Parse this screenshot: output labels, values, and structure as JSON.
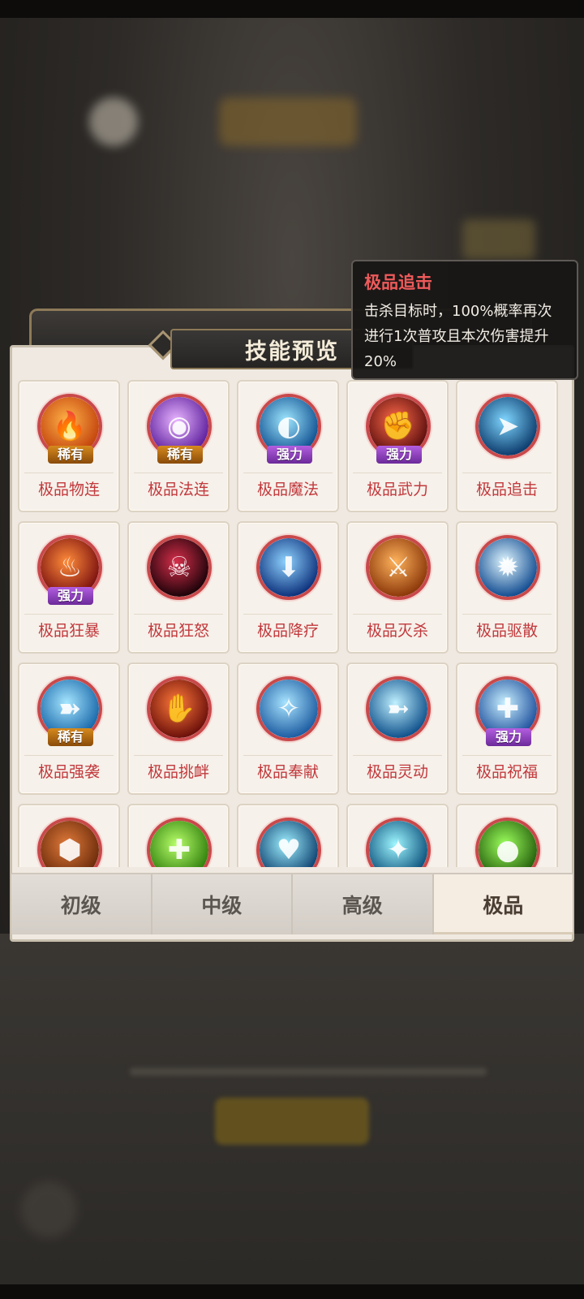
{
  "panel": {
    "title": "技能预览"
  },
  "tooltip": {
    "title": "极品追击",
    "description": "击杀目标时，100%概率再次进行1次普攻且本次伤害提升20%"
  },
  "skills": [
    {
      "label": "极品物连",
      "badge": "稀有",
      "badge_type": "rare",
      "icon": "fire-swirl-icon",
      "colors": [
        "#ffb347",
        "#c2410c"
      ]
    },
    {
      "label": "极品法连",
      "badge": "稀有",
      "badge_type": "rare",
      "icon": "magic-orb-icon",
      "colors": [
        "#e8b4ff",
        "#5b1d9b"
      ]
    },
    {
      "label": "极品魔法",
      "badge": "强力",
      "badge_type": "strong",
      "icon": "water-swirl-icon",
      "colors": [
        "#9ee7ff",
        "#0e4e8f"
      ]
    },
    {
      "label": "极品武力",
      "badge": "强力",
      "badge_type": "strong",
      "icon": "red-fist-icon",
      "colors": [
        "#ff6b4a",
        "#5a0d0d"
      ]
    },
    {
      "label": "极品追击",
      "badge": "",
      "badge_type": "",
      "icon": "running-figure-icon",
      "colors": [
        "#7fd6ff",
        "#0b3a6b"
      ]
    },
    {
      "label": "极品狂暴",
      "badge": "强力",
      "badge_type": "strong",
      "icon": "rage-figure-icon",
      "colors": [
        "#ff8c3a",
        "#7a0f0f"
      ]
    },
    {
      "label": "极品狂怒",
      "badge": "",
      "badge_type": "",
      "icon": "demon-face-icon",
      "colors": [
        "#d62e4a",
        "#1a0208"
      ]
    },
    {
      "label": "极品降疗",
      "badge": "",
      "badge_type": "",
      "icon": "down-arrow-icon",
      "colors": [
        "#8fd3ff",
        "#0b2f7a"
      ]
    },
    {
      "label": "极品灭杀",
      "badge": "",
      "badge_type": "",
      "icon": "fighter-icon",
      "colors": [
        "#ffb35c",
        "#8a3608"
      ]
    },
    {
      "label": "极品驱散",
      "badge": "",
      "badge_type": "",
      "icon": "light-burst-icon",
      "colors": [
        "#e0f6ff",
        "#0f4a8f"
      ]
    },
    {
      "label": "极品强袭",
      "badge": "稀有",
      "badge_type": "rare",
      "icon": "feather-icon",
      "colors": [
        "#a6e6ff",
        "#1565a8"
      ]
    },
    {
      "label": "极品挑衅",
      "badge": "",
      "badge_type": "",
      "icon": "taunt-hand-icon",
      "colors": [
        "#ff7a3a",
        "#6a0e0a"
      ]
    },
    {
      "label": "极品奉献",
      "badge": "",
      "badge_type": "",
      "icon": "spirit-icon",
      "colors": [
        "#a8e4ff",
        "#1b5aa0"
      ]
    },
    {
      "label": "极品灵动",
      "badge": "",
      "badge_type": "",
      "icon": "dash-figure-icon",
      "colors": [
        "#bff0ff",
        "#0d4f8a"
      ]
    },
    {
      "label": "极品祝福",
      "badge": "强力",
      "badge_type": "strong",
      "icon": "plus-sparkle-icon",
      "colors": [
        "#c8f0ff",
        "#1d4f9c"
      ]
    },
    {
      "label": "",
      "badge": "",
      "badge_type": "",
      "icon": "armor-icon",
      "colors": [
        "#e07a3a",
        "#6a2a0a"
      ]
    },
    {
      "label": "",
      "badge": "",
      "badge_type": "",
      "icon": "heal-cross-icon",
      "colors": [
        "#b8ff6a",
        "#2e7d0b"
      ]
    },
    {
      "label": "",
      "badge": "",
      "badge_type": "",
      "icon": "heart-halo-icon",
      "colors": [
        "#9ef0ff",
        "#0c3f6e"
      ]
    },
    {
      "label": "",
      "badge": "",
      "badge_type": "",
      "icon": "sparkle-beam-icon",
      "colors": [
        "#9ef7ff",
        "#0a4e7a"
      ]
    },
    {
      "label": "",
      "badge": "",
      "badge_type": "",
      "icon": "poison-cup-icon",
      "colors": [
        "#9cff5c",
        "#235d0b"
      ]
    }
  ],
  "tabs": [
    {
      "label": "初级",
      "active": false
    },
    {
      "label": "中级",
      "active": false
    },
    {
      "label": "高级",
      "active": false
    },
    {
      "label": "极品",
      "active": true
    }
  ]
}
